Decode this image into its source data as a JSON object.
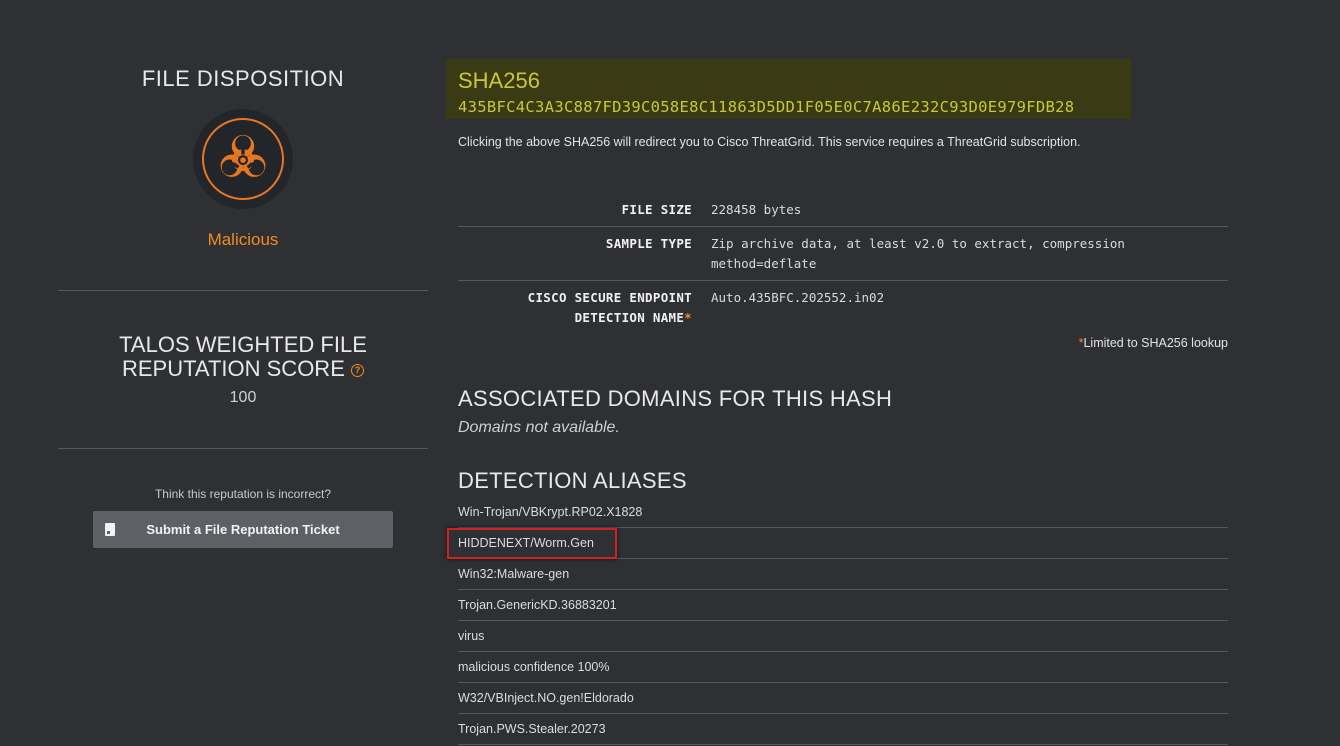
{
  "disposition": {
    "title": "FILE DISPOSITION",
    "icon": "biohazard-icon",
    "value": "Malicious",
    "accent_color": "#f08a24"
  },
  "reputation": {
    "title": "TALOS WEIGHTED FILE REPUTATION SCORE",
    "help_icon": "?",
    "score": "100",
    "incorrect_text": "Think this reputation is incorrect?",
    "ticket_button": "Submit a File Reputation Ticket"
  },
  "sha": {
    "label": "SHA256",
    "value": "435BFC4C3A3C887FD39C058E8C11863D5DD1F05E0C7A86E232C93D0E979FDB28",
    "note": "Clicking the above SHA256 will redirect you to Cisco ThreatGrid. This service requires a ThreatGrid subscription."
  },
  "file_info": {
    "file_size_key": "FILE SIZE",
    "file_size_val": "228458 bytes",
    "sample_type_key": "SAMPLE TYPE",
    "sample_type_val": "Zip archive data, at least v2.0 to extract, compression method=deflate",
    "detection_key_line1": "CISCO SECURE ENDPOINT",
    "detection_key_line2": "DETECTION NAME",
    "detection_val": "Auto.435BFC.202552.in02",
    "asterisk": "*",
    "limit_note": "Limited to SHA256 lookup"
  },
  "domains": {
    "title": "ASSOCIATED DOMAINS FOR THIS HASH",
    "empty_text": "Domains not available."
  },
  "aliases": {
    "title": "DETECTION ALIASES",
    "items": [
      "Win-Trojan/VBKrypt.RP02.X1828",
      "HIDDENEXT/Worm.Gen",
      "Win32:Malware-gen",
      "Trojan.GenericKD.36883201",
      "virus",
      "malicious confidence 100%",
      "W32/VBInject.NO.gen!Eldorado",
      "Trojan.PWS.Stealer.20273"
    ]
  }
}
